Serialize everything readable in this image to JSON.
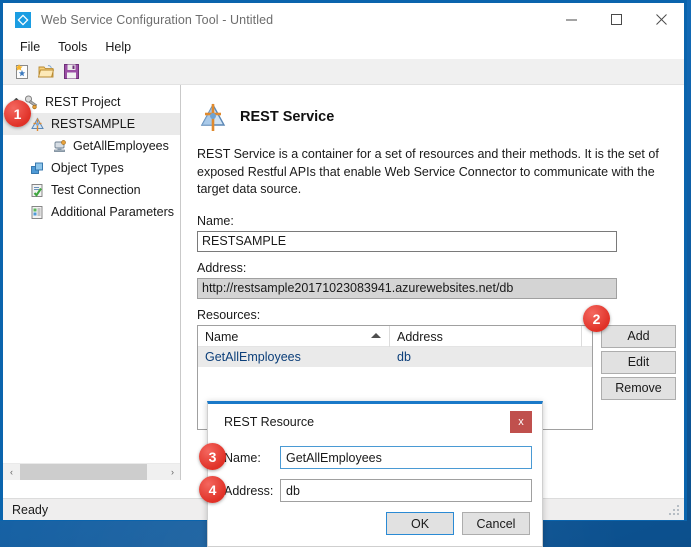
{
  "window": {
    "title": "Web Service Configuration Tool - Untitled",
    "app_icon": "diamond-app-icon",
    "controls": {
      "minimize": "—",
      "maximize": "□",
      "close": "✕"
    }
  },
  "menubar": {
    "items": [
      {
        "label": "File"
      },
      {
        "label": "Tools"
      },
      {
        "label": "Help"
      }
    ]
  },
  "toolbar": {
    "buttons": [
      {
        "name": "new-project-icon",
        "tooltip": "New"
      },
      {
        "name": "open-project-icon",
        "tooltip": "Open"
      },
      {
        "name": "save-project-icon",
        "tooltip": "Save"
      }
    ]
  },
  "tree": {
    "nodes": [
      {
        "label": "REST Project",
        "icon": "rest-project-icon",
        "level": 0,
        "expanded": true,
        "selected": false
      },
      {
        "label": "RESTSAMPLE",
        "icon": "rest-service-icon",
        "level": 1,
        "expanded": false,
        "selected": true
      },
      {
        "label": "GetAllEmployees",
        "icon": "rest-resource-icon",
        "level": 2,
        "expanded": false,
        "selected": false
      },
      {
        "label": "Object Types",
        "icon": "object-types-icon",
        "level": 1,
        "expanded": false,
        "selected": false
      },
      {
        "label": "Test Connection",
        "icon": "test-connection-icon",
        "level": 1,
        "expanded": false,
        "selected": false
      },
      {
        "label": "Additional Parameters",
        "icon": "additional-parameters-icon",
        "level": 1,
        "expanded": false,
        "selected": false
      }
    ],
    "scrollbar": {
      "left_arrow": "‹",
      "right_arrow": "›"
    }
  },
  "main": {
    "heading": "REST Service",
    "description": "REST Service is a container for a set of resources and their methods. It is the set of exposed Restful APIs that enable Web Service Connector to communicate with the target data source.",
    "name_label": "Name:",
    "name_value": "RESTSAMPLE",
    "address_label": "Address:",
    "address_value": "http://restsample20171023083941.azurewebsites.net/db",
    "resources_label": "Resources:",
    "list": {
      "columns": [
        "Name",
        "Address"
      ],
      "sorted_column": "Name",
      "sort_direction": "ascending",
      "rows": [
        {
          "name": "GetAllEmployees",
          "address": "db"
        }
      ]
    },
    "buttons": [
      {
        "label": "Add",
        "name": "add-button"
      },
      {
        "label": "Edit",
        "name": "edit-button"
      },
      {
        "label": "Remove",
        "name": "remove-button"
      }
    ]
  },
  "dialog": {
    "title": "REST Resource",
    "close_label": "x",
    "name_label": "Name:",
    "name_value": "GetAllEmployees",
    "address_label": "Address:",
    "address_value": "db",
    "ok_label": "OK",
    "cancel_label": "Cancel"
  },
  "statusbar": {
    "text": "Ready"
  },
  "callouts": [
    {
      "number": "1",
      "target": "tree-node-restsample"
    },
    {
      "number": "2",
      "target": "add-button"
    },
    {
      "number": "3",
      "target": "dialog-name-field"
    },
    {
      "number": "4",
      "target": "dialog-address-field"
    }
  ],
  "colors": {
    "accent_blue": "#0a64ad",
    "badge_red": "#e03127",
    "dialog_border_blue": "#1a79c8",
    "link_text": "#0c3f7a"
  }
}
